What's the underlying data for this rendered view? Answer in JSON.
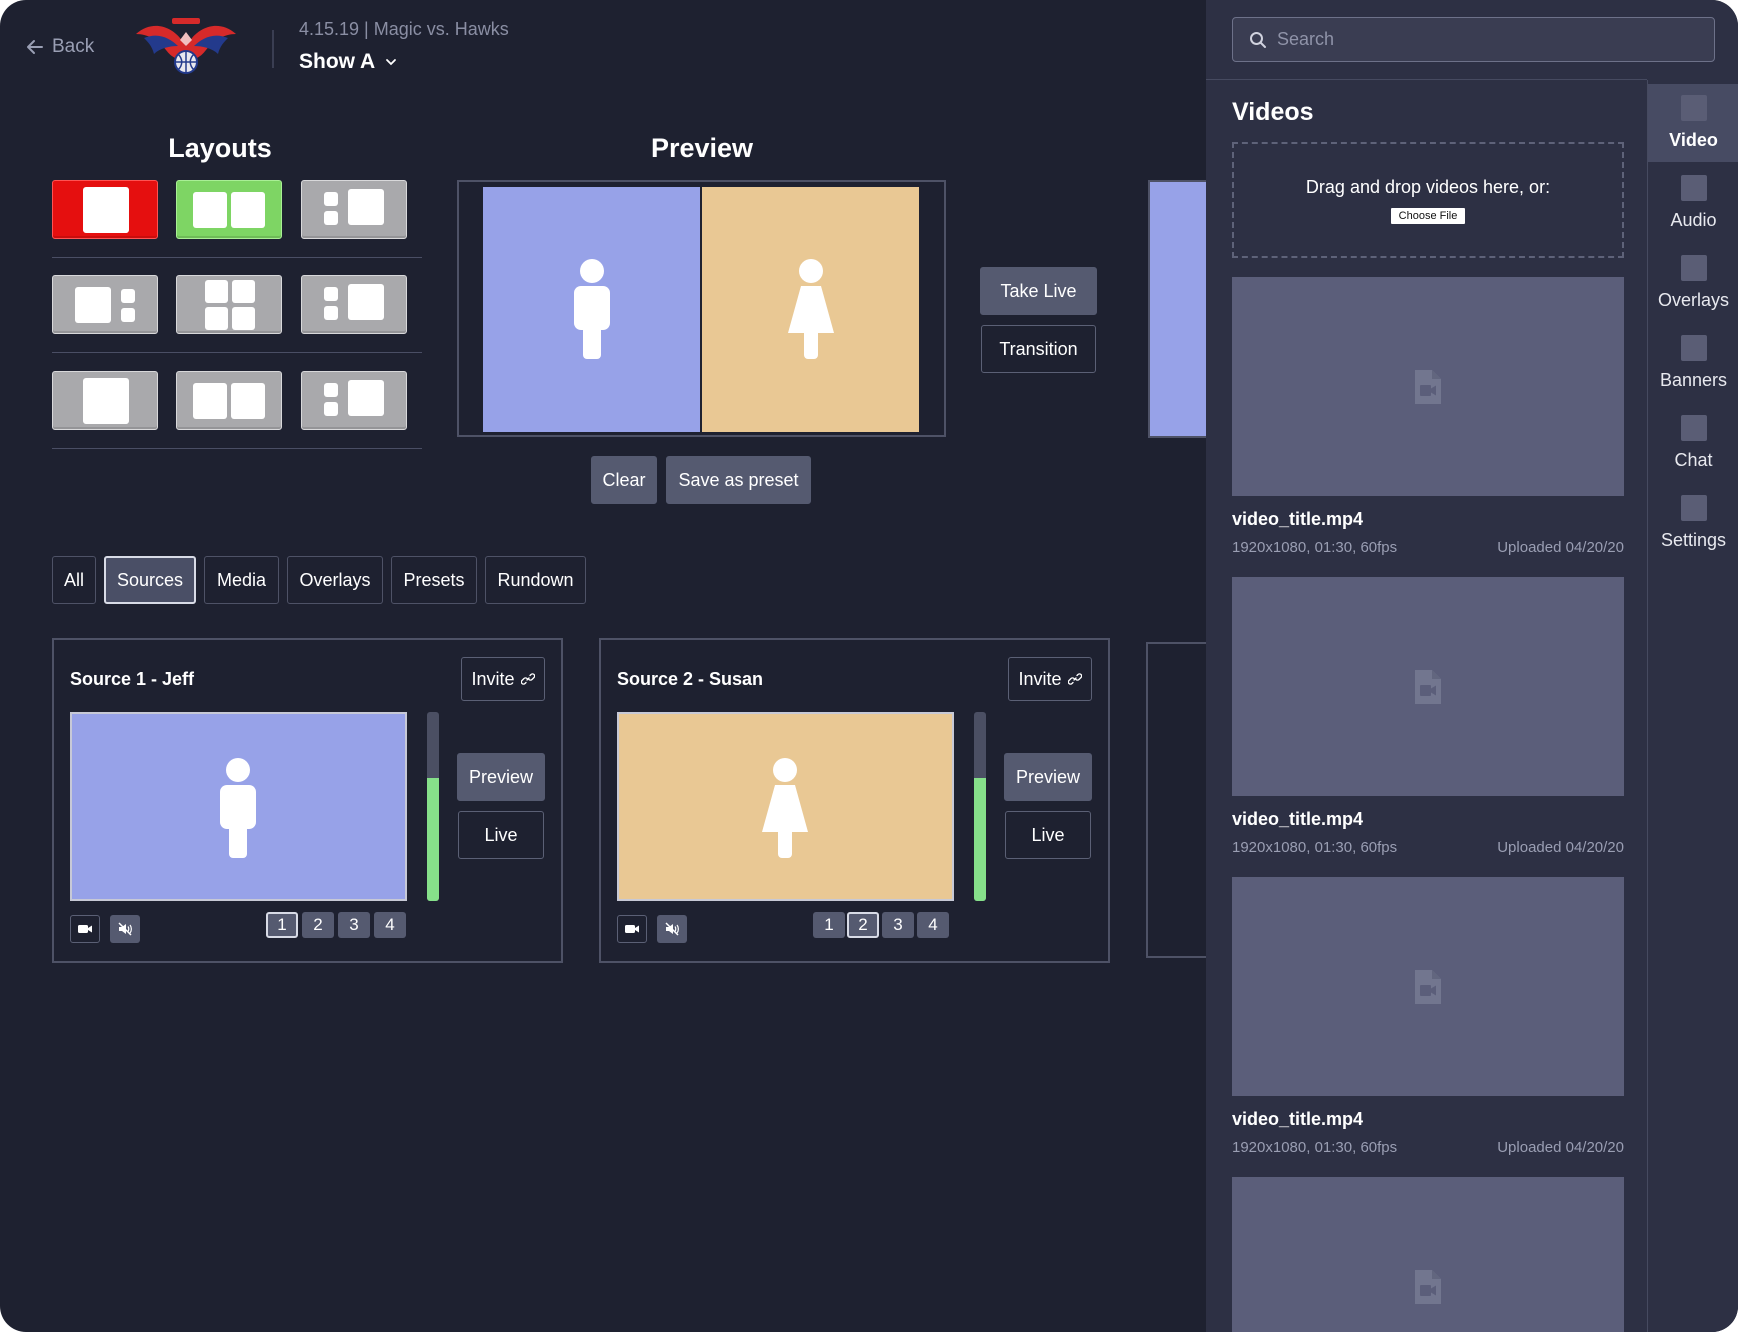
{
  "header": {
    "back_label": "Back",
    "event_meta": "4.15.19 | Magic vs. Hawks",
    "show_name": "Show A"
  },
  "layouts": {
    "title": "Layouts"
  },
  "preview": {
    "title": "Preview",
    "take_live_label": "Take Live",
    "transition_label": "Transition",
    "clear_label": "Clear",
    "save_preset_label": "Save as preset"
  },
  "filters": {
    "tabs": [
      "All",
      "Sources",
      "Media",
      "Overlays",
      "Presets",
      "Rundown"
    ],
    "active": "Sources"
  },
  "sources": [
    {
      "title": "Source 1 - Jeff",
      "invite_label": "Invite",
      "preview_label": "Preview",
      "live_label": "Live",
      "numbers": [
        "1",
        "2",
        "3",
        "4"
      ],
      "selected_number": "1",
      "audio_level": 0.65
    },
    {
      "title": "Source 2 - Susan",
      "invite_label": "Invite",
      "preview_label": "Preview",
      "live_label": "Live",
      "numbers": [
        "1",
        "2",
        "3",
        "4"
      ],
      "selected_number": "2",
      "audio_level": 0.65
    }
  ],
  "right_panel": {
    "search_placeholder": "Search",
    "section_title": "Videos",
    "dropzone_text": "Drag and drop videos here, or:",
    "choose_file_label": "Choose File",
    "videos": [
      {
        "name": "video_title.mp4",
        "specs": "1920x1080, 01:30, 60fps",
        "uploaded": "Uploaded 04/20/20"
      },
      {
        "name": "video_title.mp4",
        "specs": "1920x1080, 01:30, 60fps",
        "uploaded": "Uploaded 04/20/20"
      },
      {
        "name": "video_title.mp4",
        "specs": "1920x1080, 01:30, 60fps",
        "uploaded": "Uploaded 04/20/20"
      }
    ],
    "rail": [
      "Video",
      "Audio",
      "Overlays",
      "Banners",
      "Chat",
      "Settings"
    ],
    "rail_active": "Video"
  },
  "colors": {
    "background": "#1e2130",
    "panel": "#2d3044",
    "accent_red": "#e50f0f",
    "accent_green": "#7ed564",
    "feed_blue": "#97a2e8",
    "feed_tan": "#e9c894",
    "meter_green": "#86e08a"
  }
}
